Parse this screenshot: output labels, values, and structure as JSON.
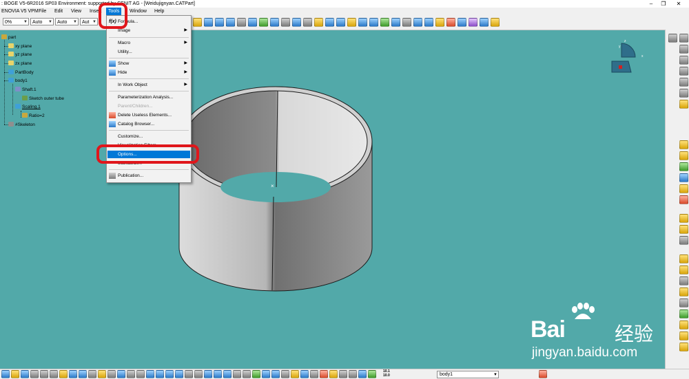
{
  "window": {
    "title": ": BOGE V5-6R2016 SP03 Environment: supported by CENIT AG - [Weidujignyan.CATPart]",
    "controls": [
      "–",
      "❐",
      "✕"
    ]
  },
  "menubar": {
    "items": [
      "ENOVIA V5 VPM",
      "File",
      "Edit",
      "View",
      "Insert",
      "Tools",
      "Window",
      "Help"
    ],
    "active": "Tools"
  },
  "toolbar": {
    "zoom_value": "0%",
    "combo1": "Auto",
    "combo2": "Auto",
    "combo3": "Aut"
  },
  "tree": {
    "root": "part",
    "nodes": [
      "xy plane",
      "yz plane",
      "zx plane",
      "PartBody",
      "body1",
      "Shaft.1",
      "Sketch outer tube",
      "Scaling.1",
      "Ratio=2",
      "#Skeleton"
    ]
  },
  "tools_menu": {
    "items": [
      {
        "label": "Formula...",
        "icon": "formula-icon",
        "submenu": false,
        "disabled": false
      },
      {
        "label": "Image",
        "submenu": true,
        "disabled": false
      },
      {
        "label": "Macro",
        "submenu": true,
        "disabled": false
      },
      {
        "label": "Utility...",
        "submenu": false,
        "disabled": false
      },
      {
        "label": "Show",
        "icon": "show-icon",
        "submenu": true,
        "disabled": false
      },
      {
        "label": "Hide",
        "icon": "hide-icon",
        "submenu": true,
        "disabled": false
      },
      {
        "label": "In Work Object",
        "submenu": true,
        "disabled": false
      },
      {
        "label": "Parameterization Analysis...",
        "submenu": false,
        "disabled": false
      },
      {
        "label": "Parent/Children...",
        "submenu": false,
        "disabled": true
      },
      {
        "label": "Delete Useless Elements...",
        "icon": "delete-icon",
        "submenu": false,
        "disabled": false
      },
      {
        "label": "Catalog Browser...",
        "icon": "catalog-icon",
        "submenu": false,
        "disabled": false
      },
      {
        "label": "Customize...",
        "submenu": false,
        "disabled": false
      },
      {
        "label": "Visualization Filters...",
        "submenu": false,
        "disabled": false
      },
      {
        "label": "Options...",
        "submenu": false,
        "disabled": false,
        "highlighted": true
      },
      {
        "label": "Standards...",
        "submenu": false,
        "disabled": false
      },
      {
        "label": "Publication...",
        "icon": "publication-icon",
        "submenu": false,
        "disabled": false
      }
    ]
  },
  "compass": {
    "axis_x": "x",
    "axis_y": "y",
    "axis_z": "z"
  },
  "bottom": {
    "current_body": "body1",
    "zoom_readout_top": "10.1",
    "zoom_readout_bottom": "10.0"
  },
  "watermark": {
    "logo": "Bai",
    "brand_cn": "经验",
    "url": "jingyan.baidu.com"
  },
  "colors": {
    "background": "#52a9a9",
    "highlight": "#0078d7",
    "annotation": "#e0161b"
  }
}
